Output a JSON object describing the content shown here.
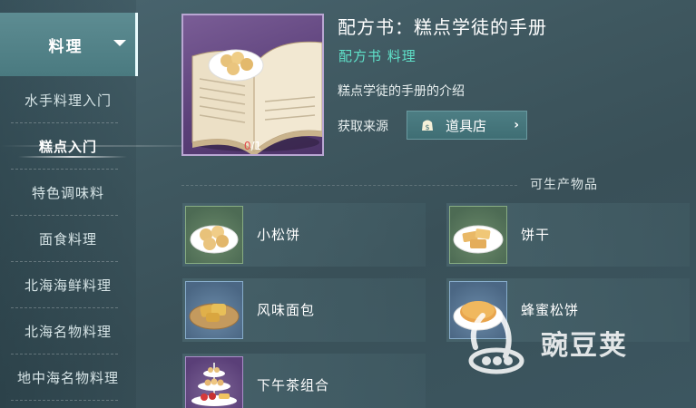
{
  "sidebar": {
    "header_label": "料理",
    "items": [
      {
        "label": "水手料理入门",
        "active": false
      },
      {
        "label": "糕点入门",
        "active": true
      },
      {
        "label": "特色调味料",
        "active": false
      },
      {
        "label": "面食料理",
        "active": false
      },
      {
        "label": "北海海鲜料理",
        "active": false
      },
      {
        "label": "北海名物料理",
        "active": false
      },
      {
        "label": "地中海名物料理",
        "active": false
      }
    ]
  },
  "recipe": {
    "title": "配方书：糕点学徒的手册",
    "type_tag": "配方书 料理",
    "description": "糕点学徒的手册的介绍",
    "source_label": "获取来源",
    "source_button": "道具店",
    "count_have": "0",
    "count_total": "/1"
  },
  "products": {
    "section_title": "可生产物品",
    "items": [
      {
        "name": "小松饼"
      },
      {
        "name": "饼干"
      },
      {
        "name": "风味面包"
      },
      {
        "name": "蜂蜜松饼"
      },
      {
        "name": "下午茶组合"
      }
    ]
  },
  "watermark": {
    "text": "豌豆荚"
  },
  "colors": {
    "accent_green": "#5fe0c8",
    "count_red": "#e24d4d",
    "rarity_purple": "#5a3f78",
    "rarity_green": "#4d6b54",
    "rarity_blue": "#4b6784"
  },
  "icons": {
    "dropdown": "chevron-down-icon",
    "bag": "bag-icon",
    "arrow": "chevron-right-icon"
  }
}
